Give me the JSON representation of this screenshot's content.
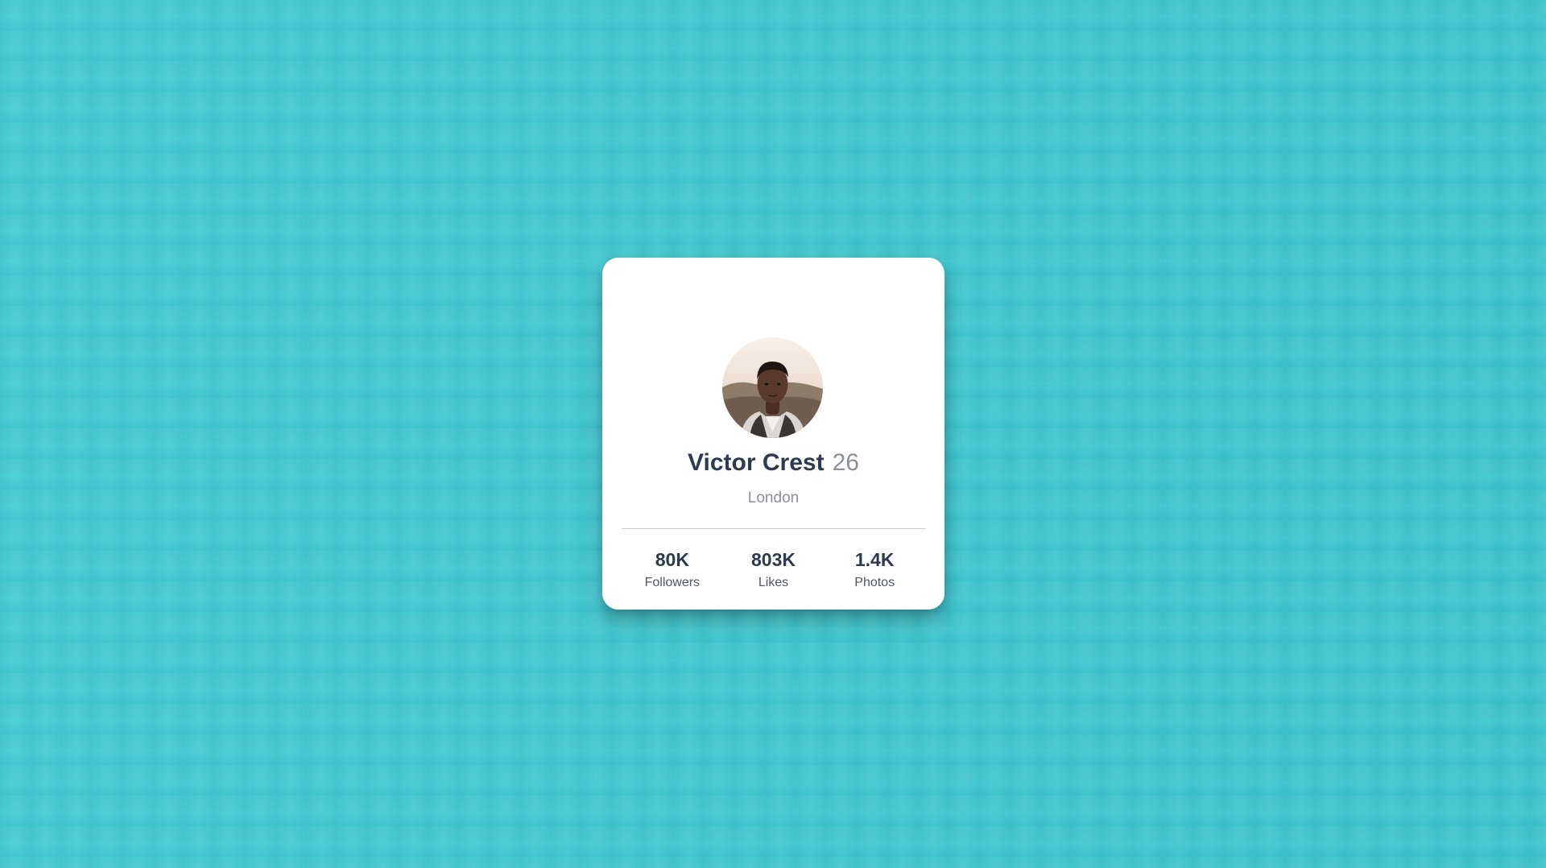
{
  "profile": {
    "name": "Victor Crest",
    "age": "26",
    "city": "London"
  },
  "stats": [
    {
      "value": "80K",
      "label": "Followers"
    },
    {
      "value": "803K",
      "label": "Likes"
    },
    {
      "value": "1.4K",
      "label": "Photos"
    }
  ],
  "colors": {
    "background": "#3cc8d2",
    "card": "#ffffff",
    "text_primary": "#2e3a4f",
    "text_muted": "#8a8f99"
  }
}
